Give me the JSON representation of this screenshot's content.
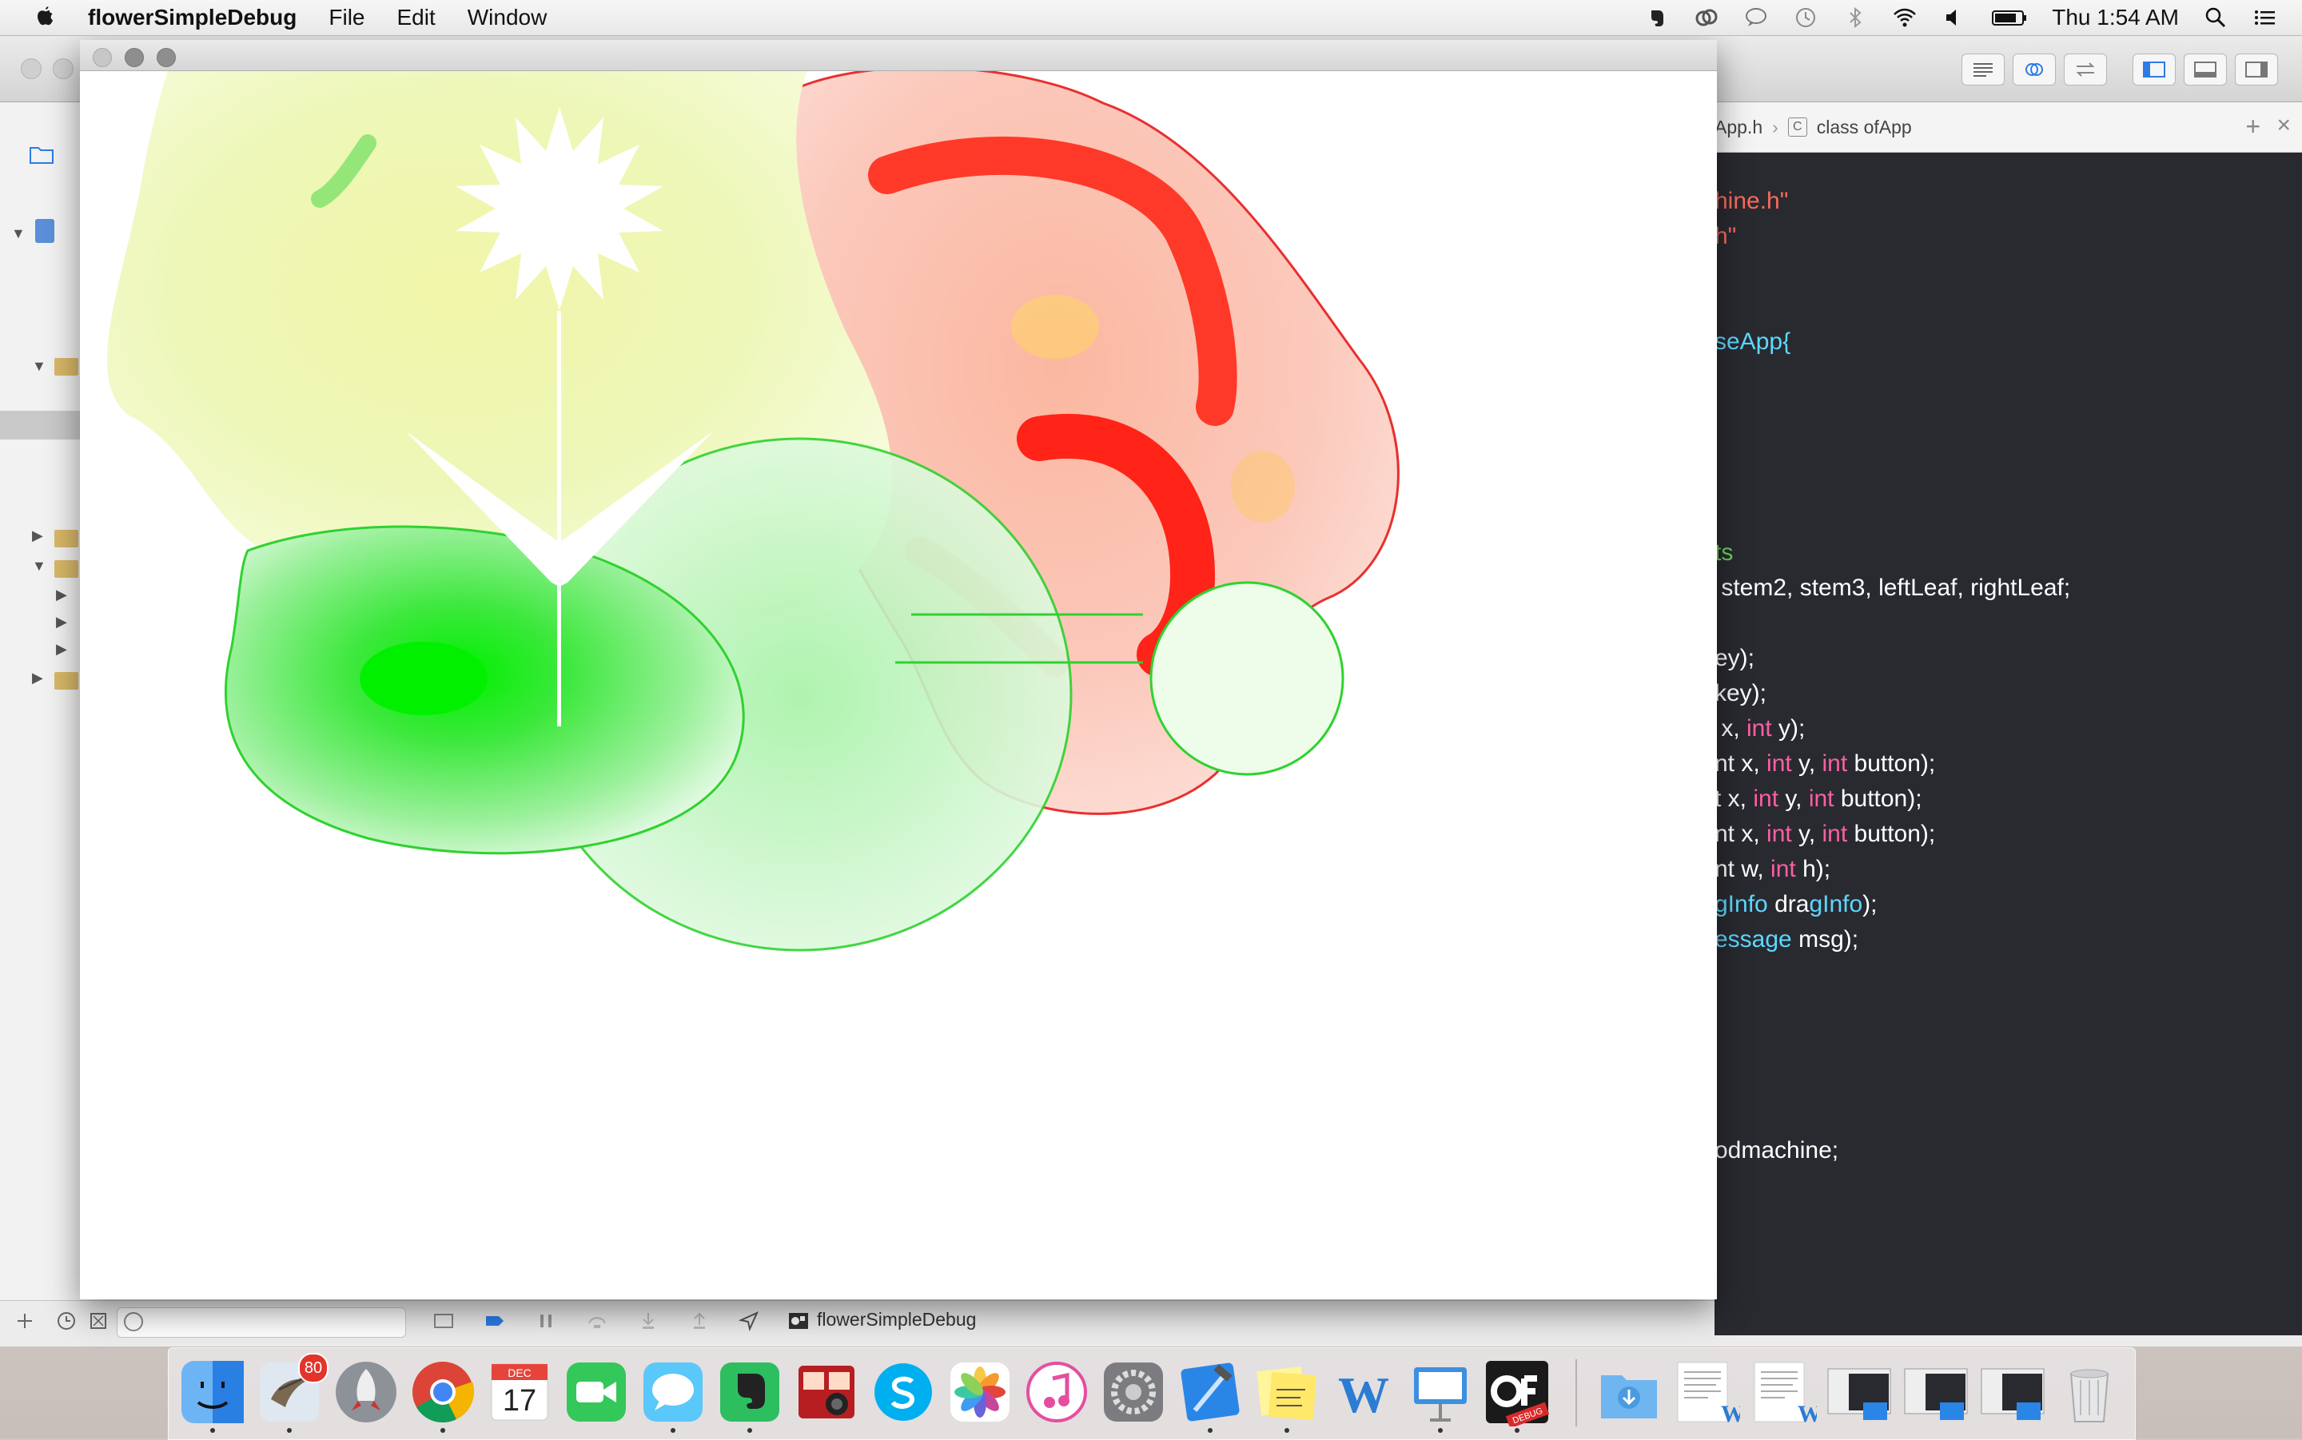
{
  "menubar": {
    "app_name": "flowerSimpleDebug",
    "menus": [
      "File",
      "Edit",
      "Window"
    ],
    "clock": "Thu 1:54 AM"
  },
  "xcode": {
    "jumpbar": {
      "file": "App.h",
      "symbol": "class ofApp"
    },
    "code_lines": [
      {
        "text": "hine.h\"",
        "kind": "str"
      },
      {
        "text": "h\"",
        "kind": "str"
      },
      {
        "text": "seApp{",
        "kind": "ty"
      },
      {
        "text": "ts",
        "kind": "cm"
      },
      {
        "text": " stem2, stem3, leftLeaf, rightLeaf;",
        "kind": "plain"
      },
      {
        "text": "ey);",
        "kind": "plain"
      },
      {
        "text": "key);",
        "kind": "plain"
      },
      {
        "text": " x, int y);",
        "kind": "mixed"
      },
      {
        "text": "nt x, int y, int button);",
        "kind": "mixed"
      },
      {
        "text": "t x, int y, int button);",
        "kind": "mixed"
      },
      {
        "text": "nt x, int y, int button);",
        "kind": "mixed"
      },
      {
        "text": "nt w, int h);",
        "kind": "mixed"
      },
      {
        "text": "gInfo dragInfo);",
        "kind": "mixed"
      },
      {
        "text": "essage msg);",
        "kind": "mixed"
      },
      {
        "text": "odmachine;",
        "kind": "plain"
      }
    ],
    "debug_target": "flowerSimpleDebug"
  },
  "app_window": {
    "title": ""
  },
  "dock": {
    "items": [
      {
        "name": "finder-icon",
        "running": true
      },
      {
        "name": "mail-icon",
        "running": true,
        "badge": "80"
      },
      {
        "name": "launchpad-icon",
        "running": false
      },
      {
        "name": "chrome-icon",
        "running": true
      },
      {
        "name": "calendar-icon",
        "running": false,
        "month": "DEC",
        "day": "17"
      },
      {
        "name": "facetime-icon",
        "running": false
      },
      {
        "name": "messages-icon",
        "running": true
      },
      {
        "name": "evernote-icon",
        "running": true
      },
      {
        "name": "photo-booth-icon",
        "running": false
      },
      {
        "name": "skype-icon",
        "running": false
      },
      {
        "name": "photos-icon",
        "running": false
      },
      {
        "name": "itunes-icon",
        "running": false
      },
      {
        "name": "system-preferences-icon",
        "running": false
      },
      {
        "name": "xcode-icon",
        "running": true
      },
      {
        "name": "stickies-icon",
        "running": true
      },
      {
        "name": "word-icon",
        "running": false
      },
      {
        "name": "keynote-icon",
        "running": true
      },
      {
        "name": "openframeworks-debug-icon",
        "running": true,
        "label": "DEBUG"
      }
    ]
  },
  "colors": {
    "editor_bg": "#292a30",
    "keyword": "#fc5fa3",
    "type": "#5dd8ff",
    "string": "#fc6a5d",
    "comment": "#6bd45e"
  }
}
